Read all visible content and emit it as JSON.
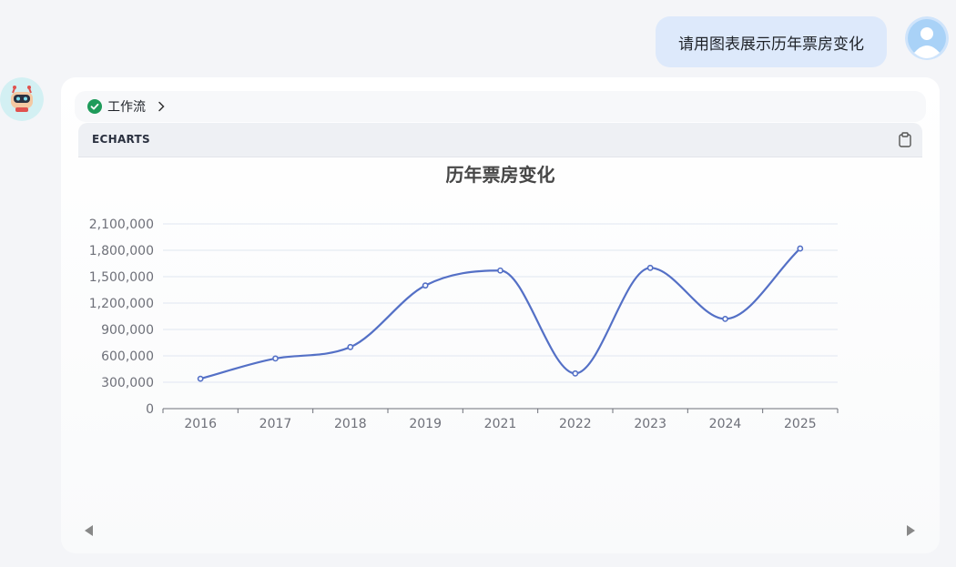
{
  "user_message": "请用图表展示历年票房变化",
  "workflow": {
    "label": "工作流"
  },
  "code_block": {
    "language": "ECHARTS"
  },
  "icons": {
    "user_avatar": "user-avatar-icon",
    "bot_avatar": "robot-avatar-icon",
    "workflow_status": "check-circle-icon",
    "workflow_expand": "chevron-right-icon",
    "copy": "clipboard-icon",
    "prev": "triangle-left-icon",
    "next": "triangle-right-icon"
  },
  "colors": {
    "series": "#5470c6",
    "status_ok": "#1e9b5a",
    "user_bubble": "#dde9fb"
  },
  "chart_data": {
    "type": "line",
    "title": "历年票房变化",
    "smooth": true,
    "categories": [
      "2016",
      "2017",
      "2018",
      "2019",
      "2021",
      "2022",
      "2023",
      "2024",
      "2025"
    ],
    "series": [
      {
        "values": [
          340000,
          570000,
          700000,
          1400000,
          1570000,
          400000,
          1600000,
          1020000,
          1820000
        ]
      }
    ],
    "y_ticks": [
      "0",
      "300,000",
      "600,000",
      "900,000",
      "1,200,000",
      "1,500,000",
      "1,800,000",
      "2,100,000"
    ],
    "ylim": [
      0,
      2100000
    ],
    "grid": true,
    "xlabel": "",
    "ylabel": ""
  }
}
